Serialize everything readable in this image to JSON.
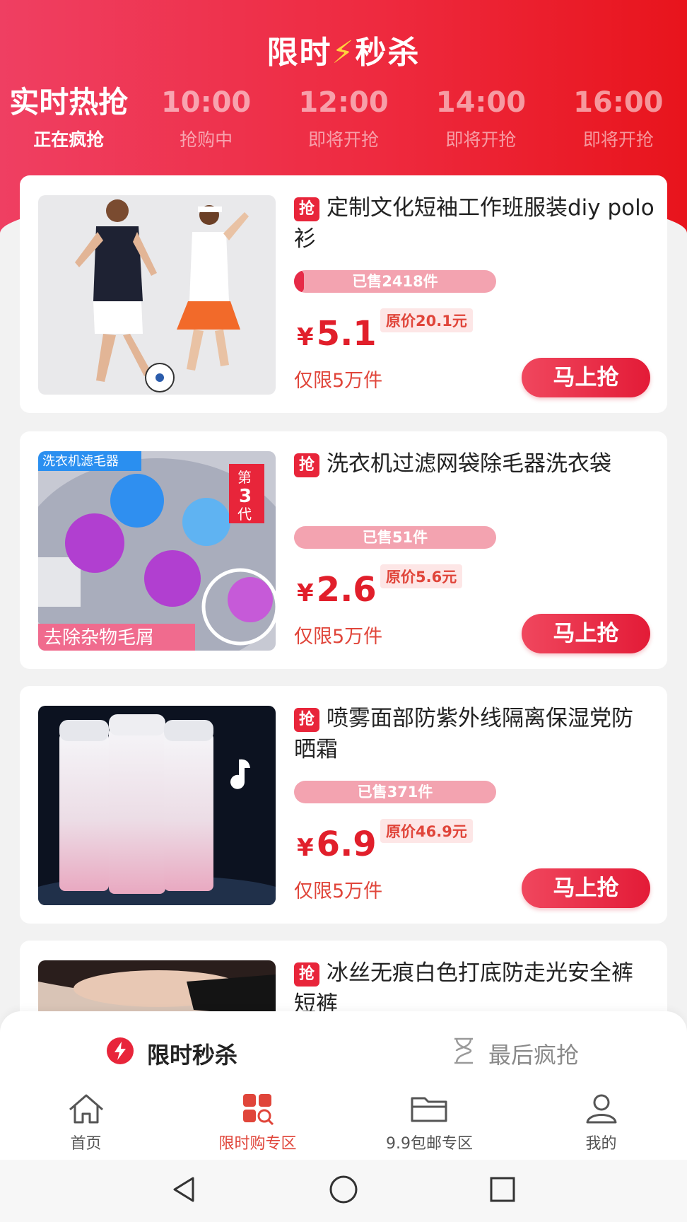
{
  "header": {
    "title_a": "限时",
    "title_bolt": "⚡",
    "title_b": "秒杀",
    "tabs": [
      {
        "time": "实时热抢",
        "status": "正在疯抢"
      },
      {
        "time": "10:00",
        "status": "抢购中"
      },
      {
        "time": "12:00",
        "status": "即将开抢"
      },
      {
        "time": "14:00",
        "status": "即将开抢"
      },
      {
        "time": "16:00",
        "status": "即将开抢"
      }
    ]
  },
  "products": [
    {
      "tag": "抢",
      "name": "定制文化短袖工作班服装diy polo衫",
      "sold": "已售2418件",
      "sold_fraction": 0.05,
      "orig_price": "原价20.1元",
      "currency": "¥",
      "price": "5.1",
      "limit": "仅限5万件",
      "buy": "马上抢"
    },
    {
      "tag": "抢",
      "name": "洗衣机过滤网袋除毛器洗衣袋",
      "sold": "已售51件",
      "sold_fraction": 0.0,
      "orig_price": "原价5.6元",
      "currency": "¥",
      "price": "2.6",
      "limit": "仅限5万件",
      "buy": "马上抢",
      "img_badge": "洗衣机滤毛器",
      "img_gen_a": "第",
      "img_gen_b": "3",
      "img_gen_c": "代",
      "img_caption": "去除杂物毛屑"
    },
    {
      "tag": "抢",
      "name": "喷雾面部防紫外线隔离保湿党防晒霜",
      "sold": "已售371件",
      "sold_fraction": 0.0,
      "orig_price": "原价46.9元",
      "currency": "¥",
      "price": "6.9",
      "limit": "仅限5万件",
      "buy": "马上抢"
    },
    {
      "tag": "抢",
      "name": "冰丝无痕白色打底防走光安全裤短裤"
    }
  ],
  "segment": {
    "active_label": "限时秒杀",
    "inactive_label": "最后疯抢"
  },
  "nav": [
    {
      "label": "首页",
      "icon": "home-icon"
    },
    {
      "label": "限时购专区",
      "icon": "flash-sale-grid-icon"
    },
    {
      "label": "9.9包邮专区",
      "icon": "folder-icon"
    },
    {
      "label": "我的",
      "icon": "user-icon"
    }
  ],
  "colors": {
    "brand_red": "#e8253a",
    "header_start": "#ef3f62",
    "header_end": "#e8141c",
    "price_red": "#e11f2b"
  }
}
